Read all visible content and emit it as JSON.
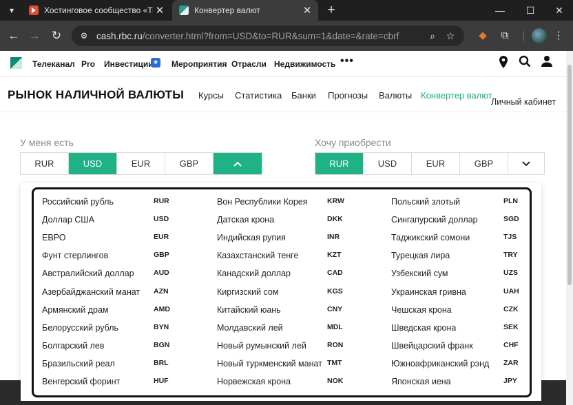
{
  "browser": {
    "tabs": [
      {
        "title": "Хостинговое сообщество «Tim",
        "active": false
      },
      {
        "title": "Конвертер валют",
        "active": true
      }
    ],
    "url_host": "cash.rbc.ru",
    "url_path": "/converter.html?from=USD&to=RUR&sum=1&date=&rate=cbrf"
  },
  "site_nav": {
    "items": [
      "Телеканал",
      "Pro",
      "Инвестиции",
      "Мероприятия",
      "Отрасли",
      "Недвижимость"
    ],
    "more": "•••"
  },
  "sub_header": {
    "title": "РЫНОК НАЛИЧНОЙ ВАЛЮТЫ",
    "links": [
      "Курсы",
      "Статистика",
      "Банки",
      "Прогнозы",
      "Валюты",
      "Конвертер валют"
    ],
    "active_link": "Конвертер валют",
    "cabinet": "Личный кабинет"
  },
  "converter": {
    "have_label": "У меня есть",
    "want_label": "Хочу приобрести",
    "have_buttons": [
      "RUR",
      "USD",
      "EUR",
      "GBP"
    ],
    "have_selected": "USD",
    "want_buttons": [
      "RUR",
      "USD",
      "EUR",
      "GBP"
    ],
    "want_selected": "RUR"
  },
  "currencies": [
    [
      {
        "name": "Российский рубль",
        "code": "RUR"
      },
      {
        "name": "Доллар США",
        "code": "USD"
      },
      {
        "name": "ЕВРО",
        "code": "EUR"
      },
      {
        "name": "Фунт стерлингов",
        "code": "GBP"
      },
      {
        "name": "Австралийский доллар",
        "code": "AUD"
      },
      {
        "name": "Азербайджанский манат",
        "code": "AZN"
      },
      {
        "name": "Армянский драм",
        "code": "AMD"
      },
      {
        "name": "Белорусский рубль",
        "code": "BYN"
      },
      {
        "name": "Болгарский лев",
        "code": "BGN"
      },
      {
        "name": "Бразильский реал",
        "code": "BRL"
      },
      {
        "name": "Венгерский форинт",
        "code": "HUF"
      }
    ],
    [
      {
        "name": "Вон Республики Корея",
        "code": "KRW"
      },
      {
        "name": "Датская крона",
        "code": "DKK"
      },
      {
        "name": "Индийская рупия",
        "code": "INR"
      },
      {
        "name": "Казахстанский тенге",
        "code": "KZT"
      },
      {
        "name": "Канадский доллар",
        "code": "CAD"
      },
      {
        "name": "Киргизский сом",
        "code": "KGS"
      },
      {
        "name": "Китайский юань",
        "code": "CNY"
      },
      {
        "name": "Молдавский лей",
        "code": "MDL"
      },
      {
        "name": "Новый румынский лей",
        "code": "RON"
      },
      {
        "name": "Новый туркменский манат",
        "code": "TMT"
      },
      {
        "name": "Норвежская крона",
        "code": "NOK"
      }
    ],
    [
      {
        "name": "Польский злотый",
        "code": "PLN"
      },
      {
        "name": "Сингапурский доллар",
        "code": "SGD"
      },
      {
        "name": "Таджикский сомони",
        "code": "TJS"
      },
      {
        "name": "Турецкая лира",
        "code": "TRY"
      },
      {
        "name": "Узбекский сум",
        "code": "UZS"
      },
      {
        "name": "Украинская гривна",
        "code": "UAH"
      },
      {
        "name": "Чешская крона",
        "code": "CZK"
      },
      {
        "name": "Шведская крона",
        "code": "SEK"
      },
      {
        "name": "Швейцарский франк",
        "code": "CHF"
      },
      {
        "name": "Южноафриканский рэнд",
        "code": "ZAR"
      },
      {
        "name": "Японская иена",
        "code": "JPY"
      }
    ]
  ],
  "colors": {
    "accent": "#1fb286",
    "active_link": "#1aab7c",
    "highlight_border": "#111111"
  },
  "icons": {
    "dropdown_collapse": "chevron-up-icon",
    "dropdown_expand": "chevron-down-icon"
  }
}
